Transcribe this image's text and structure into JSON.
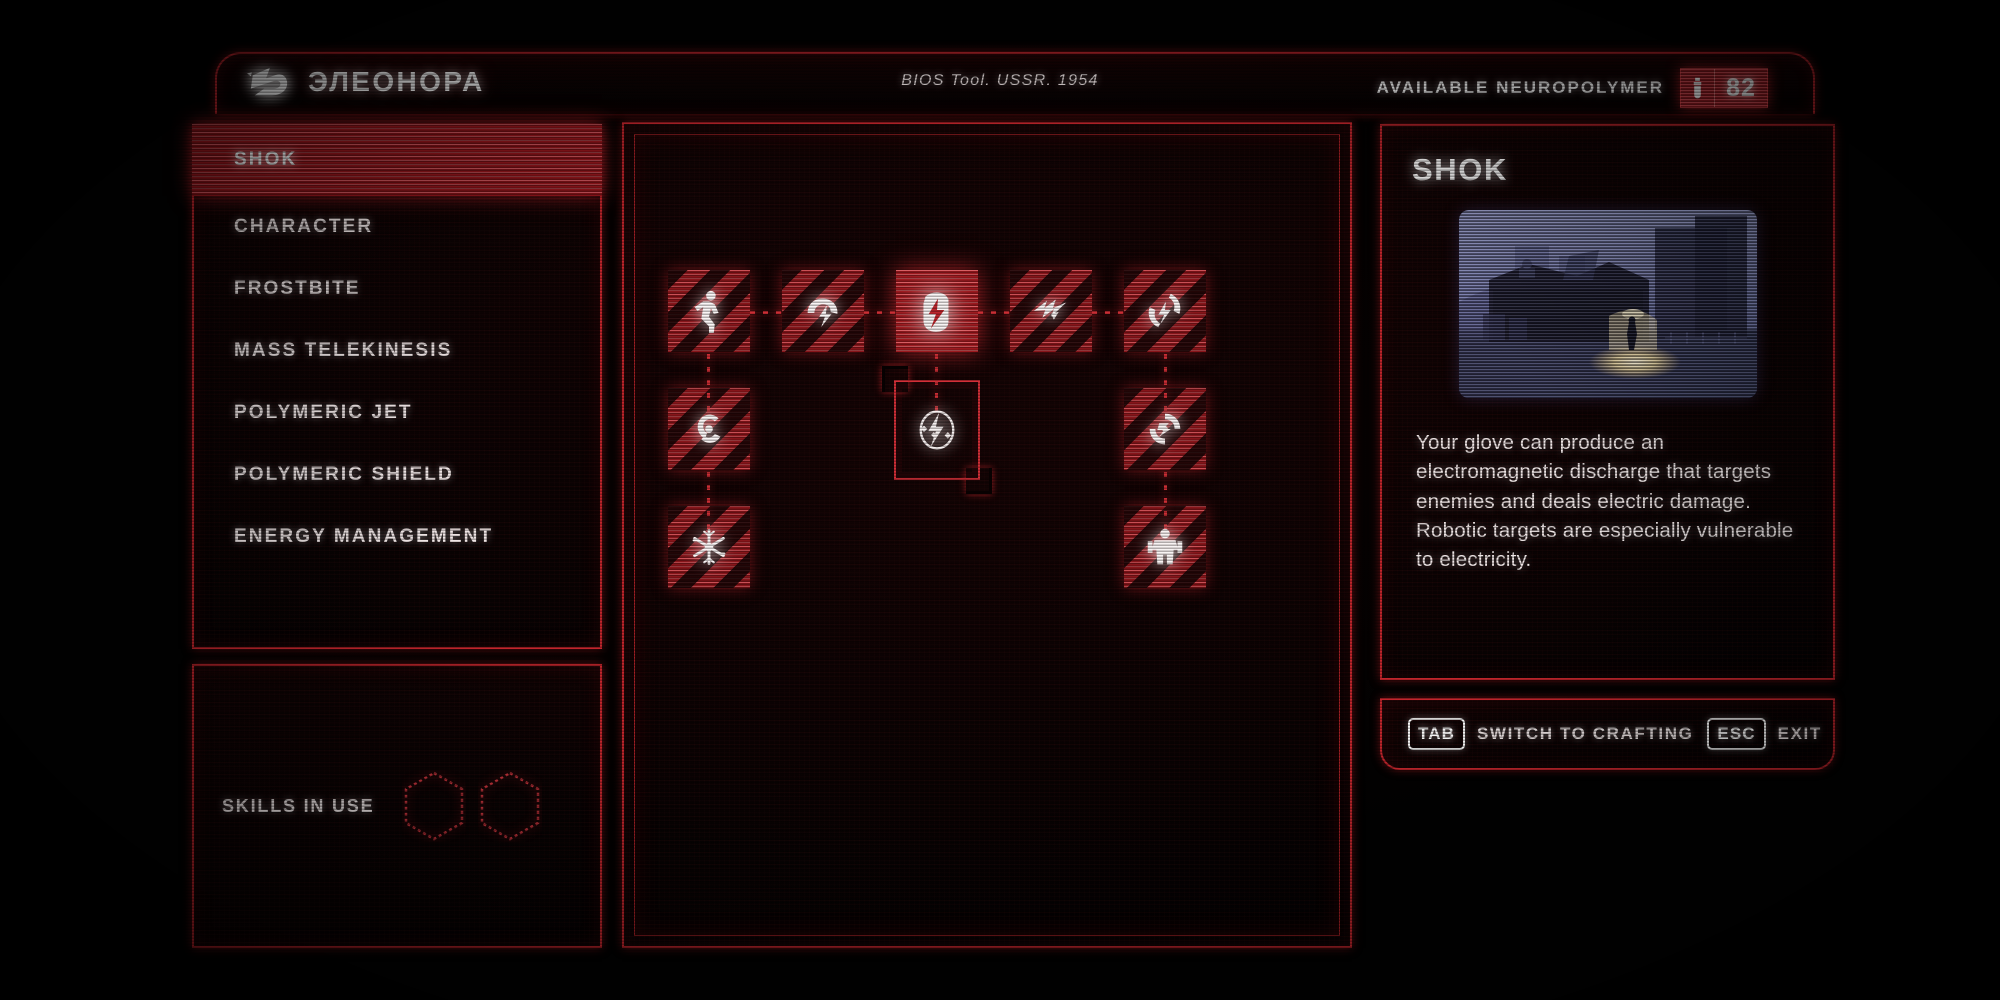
{
  "header": {
    "logo_icon": "eleonora-glove-logo-icon",
    "title": "ЭЛЕОНОРА",
    "center_text": "BIOS Tool. USSR. 1954",
    "resource_label": "AVAILABLE NEUROPOLYMER",
    "resource_icon": "neuropolymer-vial-icon",
    "resource_value": "82"
  },
  "sidebar": {
    "items": [
      {
        "label": "SHOK",
        "active": true
      },
      {
        "label": "CHARACTER",
        "active": false
      },
      {
        "label": "FROSTBITE",
        "active": false
      },
      {
        "label": "MASS TELEKINESIS",
        "active": false
      },
      {
        "label": "POLYMERIC JET",
        "active": false
      },
      {
        "label": "POLYMERIC SHIELD",
        "active": false
      },
      {
        "label": "ENERGY MANAGEMENT",
        "active": false
      }
    ]
  },
  "skills_in_use": {
    "label": "SKILLS IN USE",
    "slots": [
      {
        "icon": "empty-hex-slot-icon",
        "filled": false
      },
      {
        "icon": "empty-hex-slot-icon",
        "filled": false
      }
    ]
  },
  "skill_tree": {
    "nodes": [
      {
        "id": "n-r1c1",
        "icon": "running-figure-icon",
        "state": "locked",
        "row": 1,
        "col": 1
      },
      {
        "id": "n-r1c2",
        "icon": "shock-burst-icon",
        "state": "locked",
        "row": 1,
        "col": 2
      },
      {
        "id": "n-r1c3",
        "icon": "shock-glove-icon",
        "state": "unlocked",
        "row": 1,
        "col": 3
      },
      {
        "id": "n-r1c4",
        "icon": "lightning-arrow-icon",
        "state": "locked",
        "row": 1,
        "col": 4
      },
      {
        "id": "n-r1c5",
        "icon": "swirl-spark-icon",
        "state": "locked",
        "row": 1,
        "col": 5
      },
      {
        "id": "n-r2c1",
        "icon": "cyclone-icon",
        "state": "locked",
        "row": 2,
        "col": 1
      },
      {
        "id": "n-r2c3",
        "icon": "lightning-circle-icon",
        "state": "selected",
        "row": 2,
        "col": 3
      },
      {
        "id": "n-r2c5",
        "icon": "double-swirl-icon",
        "state": "locked",
        "row": 2,
        "col": 5
      },
      {
        "id": "n-r3c1",
        "icon": "snowflake-burst-icon",
        "state": "locked",
        "row": 3,
        "col": 1
      },
      {
        "id": "n-r3c5",
        "icon": "armored-figure-icon",
        "state": "locked",
        "row": 3,
        "col": 5
      }
    ]
  },
  "info": {
    "title": "SHOK",
    "preview_icon": "skill-preview-image",
    "description": "Your glove can produce an electromagnetic discharge that targets enemies and deals electric damage. Robotic targets are especially vulnerable to electricity."
  },
  "footer": {
    "hints": [
      {
        "key": "TAB",
        "text": "SWITCH TO CRAFTING"
      },
      {
        "key": "ESC",
        "text": "EXIT"
      }
    ]
  },
  "colors": {
    "accent_red": "#c4252c",
    "node_red": "#c0272e",
    "unlocked_red": "#cf2a31",
    "text_white": "#f2eaea",
    "background": "#010101"
  }
}
